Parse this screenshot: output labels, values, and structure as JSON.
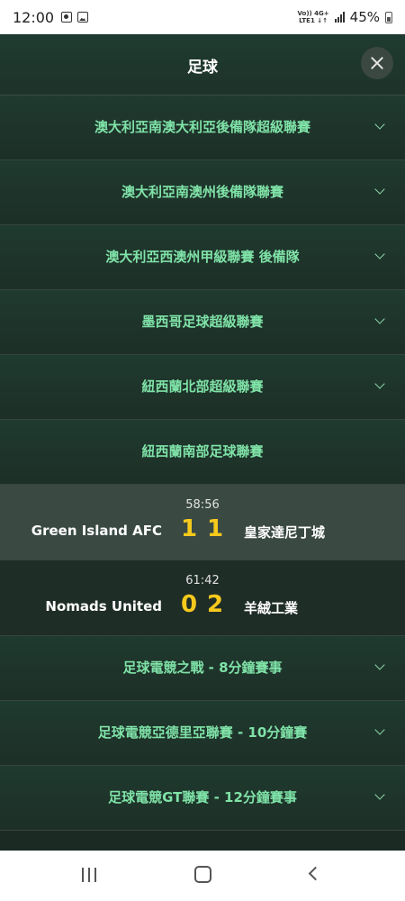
{
  "status_bar": {
    "time": "12:00",
    "network_top": "Vo)) 4G+",
    "network_bottom": "LTE1 ↓↑",
    "battery": "45%"
  },
  "header": {
    "title": "足球",
    "close_icon": "close-icon"
  },
  "leagues_top": [
    {
      "label": "澳大利亞南澳大利亞後備隊超級聯賽",
      "icon": "chevron-down-icon"
    },
    {
      "label": "澳大利亞南澳州後備隊聯賽",
      "icon": "chevron-down-icon"
    },
    {
      "label": "澳大利亞西澳州甲級聯賽 後備隊",
      "icon": "chevron-down-icon"
    },
    {
      "label": "墨西哥足球超級聯賽",
      "icon": "chevron-down-icon"
    },
    {
      "label": "紐西蘭北部超級聯賽",
      "icon": "chevron-down-icon"
    },
    {
      "label": "紐西蘭南部足球聯賽"
    }
  ],
  "matches": [
    {
      "time": "58:56",
      "home": "Green Island AFC",
      "home_score": "1",
      "away_score": "1",
      "away": "皇家達尼丁城"
    },
    {
      "time": "61:42",
      "home": "Nomads United",
      "home_score": "0",
      "away_score": "2",
      "away": "羊絨工業"
    }
  ],
  "leagues_bottom": [
    {
      "label": "足球電競之戰 - 8分鐘賽事",
      "icon": "chevron-down-icon"
    },
    {
      "label": "足球電競亞德里亞聯賽 - 10分鐘賽",
      "icon": "chevron-down-icon"
    },
    {
      "label": "足球電競GT聯賽 - 12分鐘賽事",
      "icon": "chevron-down-icon"
    }
  ],
  "colors": {
    "background": "#1c2a24",
    "league_text": "#7fe2a7",
    "score": "#f6c91c",
    "highlight_row": "#3a4a43"
  }
}
